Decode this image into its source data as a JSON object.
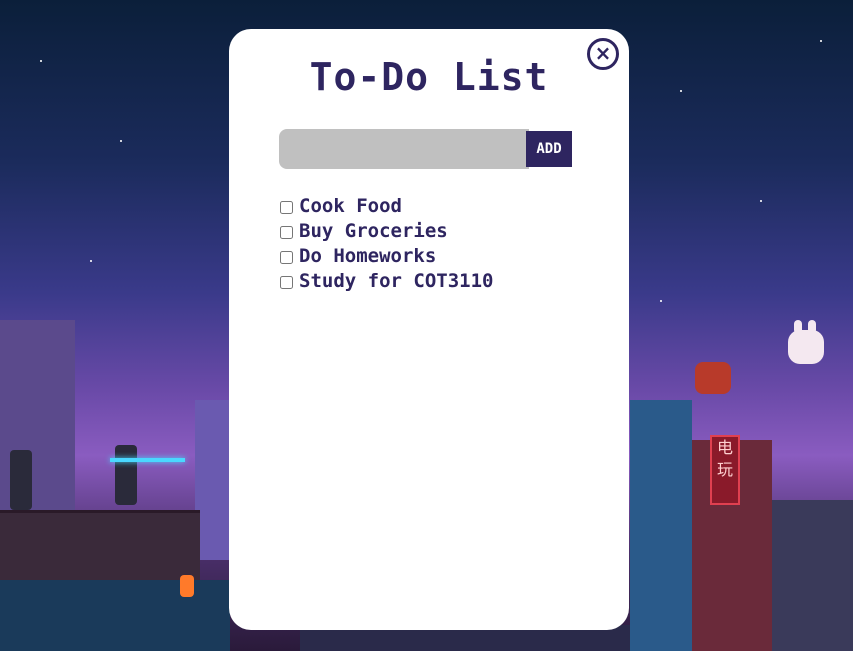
{
  "modal": {
    "close_icon": "×",
    "title": "To-Do List",
    "input_placeholder": "",
    "add_label": "ADD"
  },
  "tasks": [
    {
      "label": "Cook Food",
      "checked": false
    },
    {
      "label": "Buy Groceries",
      "checked": false
    },
    {
      "label": "Do Homeworks",
      "checked": false
    },
    {
      "label": "Study for COT3110",
      "checked": false
    }
  ],
  "background": {
    "sign_text": "电玩"
  },
  "colors": {
    "accent": "#2e2560",
    "input_bg": "#c0c0c0",
    "modal_bg": "#ffffff"
  }
}
